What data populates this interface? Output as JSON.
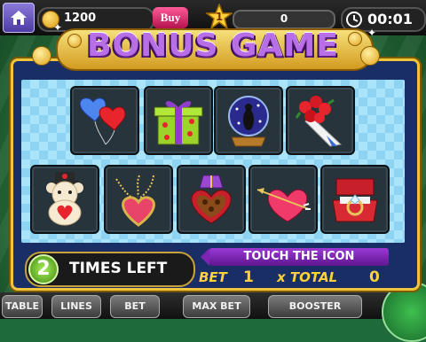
{
  "top_bar": {
    "coins": "1200",
    "buy_label": "Buy",
    "level": "1",
    "xp": "0",
    "timer": "00:01"
  },
  "bonus": {
    "title": "BONUS GAME",
    "cards": [
      {
        "icon": "balloon-hearts-icon"
      },
      {
        "icon": "gift-box-icon"
      },
      {
        "icon": "snow-globe-icon"
      },
      {
        "icon": "rose-bouquet-icon"
      },
      {
        "icon": "teddy-bear-icon"
      },
      {
        "icon": "heart-necklace-icon"
      },
      {
        "icon": "chocolate-box-icon"
      },
      {
        "icon": "arrow-heart-icon"
      },
      {
        "icon": "ring-box-icon"
      }
    ],
    "times_left_count": "2",
    "times_left_label": "TIMES LEFT",
    "instruction": "TOUCH THE ICON",
    "bet_label": "BET",
    "bet_value": "1",
    "total_label": "x TOTAL",
    "total_value": "0"
  },
  "bottom_bar": {
    "buttons": [
      "TABLE",
      "LINES",
      "BET",
      "MAX BET",
      "BOOSTER"
    ]
  },
  "colors": {
    "title_purple": "#b76ee6",
    "frame_gold": "#f2c43a",
    "banner_purple": "#9b39d6",
    "bet_yellow": "#ffd23a",
    "grid_blue": "#8fd3f2"
  }
}
